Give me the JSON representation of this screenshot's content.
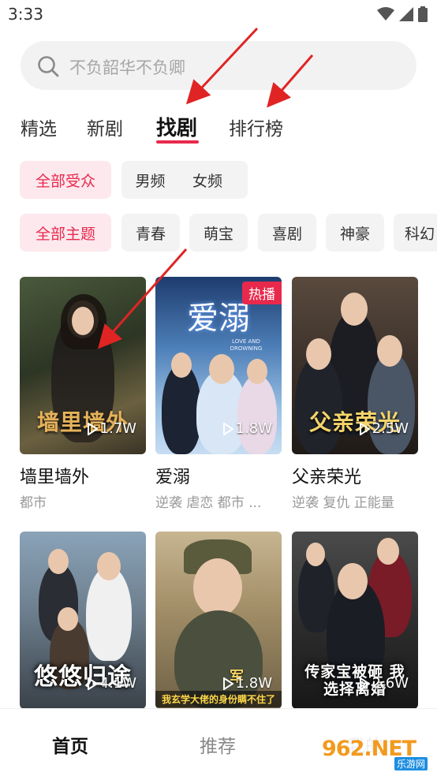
{
  "status_bar": {
    "time": "3:33"
  },
  "search": {
    "placeholder": "不负韶华不负卿"
  },
  "tabs": [
    {
      "label": "精选"
    },
    {
      "label": "新剧"
    },
    {
      "label": "找剧",
      "active": true
    },
    {
      "label": "排行榜"
    }
  ],
  "audience_filters": [
    {
      "label": "全部受众",
      "selected": true
    },
    {
      "label": "男频"
    },
    {
      "label": "女频"
    }
  ],
  "theme_filters": [
    {
      "label": "全部主题",
      "selected": true
    },
    {
      "label": "青春"
    },
    {
      "label": "萌宝"
    },
    {
      "label": "喜剧"
    },
    {
      "label": "神豪"
    },
    {
      "label": "科幻"
    }
  ],
  "dramas": [
    {
      "name": "墙里墙外",
      "tags": "都市",
      "plays": "1.7W",
      "poster_text": "墙里墙外"
    },
    {
      "name": "爱溺",
      "tags": "逆袭 虐恋 都市 ...",
      "plays": "1.8W",
      "badge": "热播",
      "poster_text": "爱溺",
      "poster_sub": "LOVE AND DROWNING"
    },
    {
      "name": "父亲荣光",
      "tags": "逆袭 复仇 正能量",
      "plays": "2.5W",
      "poster_text": "父亲荣光"
    },
    {
      "name": "",
      "tags": "",
      "plays": "4.1W",
      "poster_text": "悠悠归途"
    },
    {
      "name": "",
      "tags": "",
      "plays": "1.8W",
      "poster_text": "我玄学大佬的身份瞒不住了",
      "poster_sub": "军"
    },
    {
      "name": "",
      "tags": "",
      "plays": "2.6W",
      "poster_text": "传家宝被砸 我选择离婚"
    }
  ],
  "bottom_nav": [
    {
      "label": "首页",
      "active": true
    },
    {
      "label": "推荐"
    },
    {
      "label": "我的"
    }
  ],
  "watermark": {
    "text": "962.NET",
    "sub": "乐游网"
  },
  "colors": {
    "accent": "#e8294c",
    "chip_bg": "#f3f3f3",
    "chip_selected_bg": "#fde8ee",
    "annotation": "#e02424"
  }
}
